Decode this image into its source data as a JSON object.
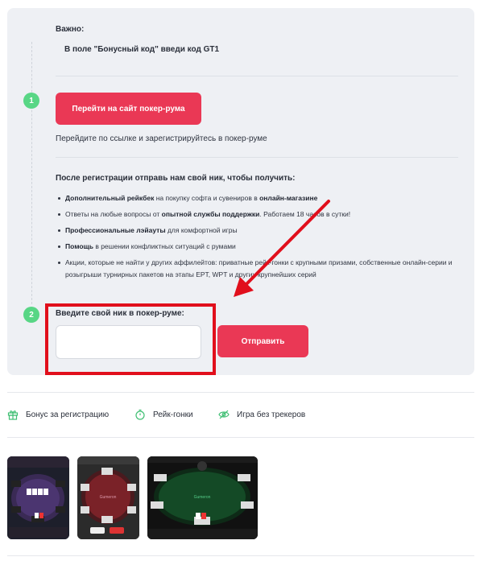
{
  "important": {
    "label": "Важно:",
    "code_text": "В поле \"Бонусный код\" введи код GT1"
  },
  "step1": {
    "number": "1",
    "button_label": "Перейти на сайт покер-рума",
    "note": "Перейдите по ссылке и зарегистрируйтесь в покер-руме"
  },
  "benefits": {
    "title": "После регистрации отправь нам свой ник, чтобы получить:",
    "items": [
      {
        "bold": "Дополнительный рейкбек",
        "text": " на покупку софта и сувениров в ",
        "bold2": "онлайн-магазине",
        "text2": ""
      },
      {
        "bold": "",
        "text": "Ответы на любые вопросы от ",
        "bold2": "опытной службы поддержки",
        "text2": ". Работаем 18 часов в сутки!"
      },
      {
        "bold": "Профессиональные лэйауты",
        "text": " для комфортной игры",
        "bold2": "",
        "text2": ""
      },
      {
        "bold": "Помощь",
        "text": " в решении конфликтных ситуаций с румами",
        "bold2": "",
        "text2": ""
      },
      {
        "bold": "",
        "text": "Акции, которые не найти у других аффилейтов: приватные рейк-гонки с крупными призами, собственные онлайн-серии и розыгрыши турнирных пакетов на этапы EPT, WPT и других крупнейших серий",
        "bold2": "",
        "text2": ""
      }
    ]
  },
  "step2": {
    "number": "2",
    "nick_label": "Введите свой ник в покер-руме:",
    "nick_value": "",
    "submit_label": "Отправить"
  },
  "features": [
    {
      "icon": "gift-icon",
      "label": "Бонус за регистрацию"
    },
    {
      "icon": "stopwatch-icon",
      "label": "Рейк-гонки"
    },
    {
      "icon": "eye-off-icon",
      "label": "Игра без трекеров"
    }
  ],
  "colors": {
    "accent_red": "#ea3855",
    "step_green": "#58d685",
    "highlight_red": "#e10f1c",
    "feature_green": "#3fbf73"
  },
  "screenshots": [
    "poker-table-purple",
    "poker-table-red",
    "poker-table-green"
  ]
}
